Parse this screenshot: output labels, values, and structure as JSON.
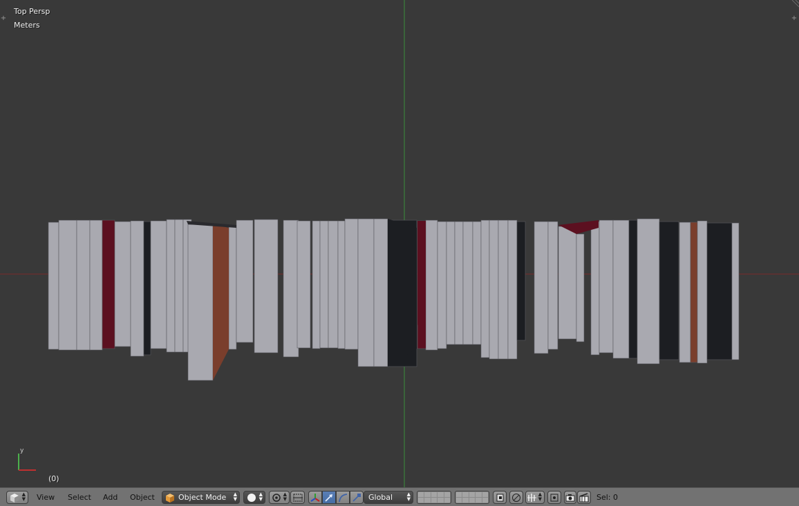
{
  "viewport": {
    "title": "Top Persp",
    "units": "Meters",
    "frame": "(0)",
    "axis_y_label": "y"
  },
  "header": {
    "menus": [
      "View",
      "Select",
      "Add",
      "Object"
    ],
    "mode_label": "Object Mode",
    "orientation_label": "Global",
    "selection_status": "Sel: 0",
    "icons": [
      "editor-type-cube-icon",
      "mode-cube-icon",
      "viewport-shading-sphere-icon",
      "pivot-point-icon",
      "manipulator-toggle-icon",
      "translate-arrow-icon",
      "rotate-arc-icon",
      "scale-arrow-icon",
      "layers-grid-icon",
      "lock-layers-icon",
      "proportional-edit-icon",
      "snap-icon",
      "snap-target-icon",
      "render-camera-icon",
      "render-animation-icon"
    ]
  },
  "colors": {
    "viewport_bg": "#393939",
    "header_bg": "#727272",
    "x_axis": "#8b2a2a",
    "y_axis": "#2e8b2e",
    "book_light": "#a9a9b0",
    "book_maroon": "#5c1020",
    "book_brown": "#7a3e2c",
    "book_dark": "#1c1e22",
    "active_button": "#5680c2"
  }
}
